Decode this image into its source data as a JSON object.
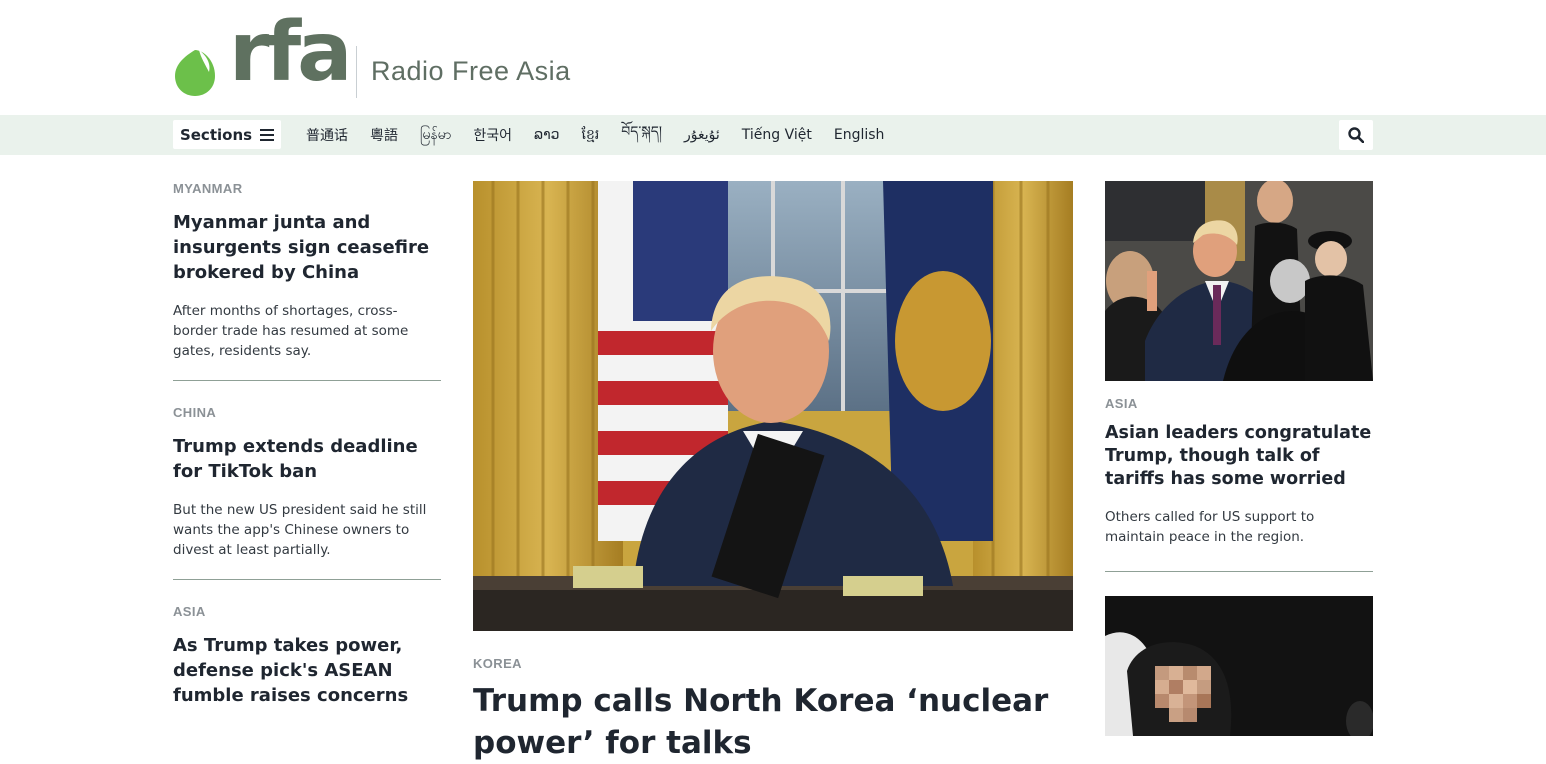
{
  "header": {
    "logo_text": "rfa",
    "tagline": "Radio Free Asia",
    "colors": {
      "brand_green": "#6cc04a",
      "logo_gray": "#5f7160",
      "nav_bg": "#eaf2ec"
    }
  },
  "nav": {
    "sections_label": "Sections",
    "sections_icon": "hamburger-icon",
    "languages": [
      "普通话",
      "粵語",
      "မြန်မာ",
      "한국어",
      "ລາວ",
      "ខ្មែរ",
      "བོད་སྐད།",
      "ئۇيغۇر",
      "Tiếng Việt",
      "English"
    ],
    "search_icon": "search-icon"
  },
  "left_stories": [
    {
      "kicker": "MYANMAR",
      "headline": "Myanmar junta and insurgents sign ceasefire brokered by China",
      "dek": "After months of shortages, cross-border trade has resumed at some gates, residents say."
    },
    {
      "kicker": "CHINA",
      "headline": "Trump extends deadline for TikTok ban",
      "dek": "But the new US president said he still wants the app's Chinese owners to divest at least partially."
    },
    {
      "kicker": "ASIA",
      "headline": "As Trump takes power, defense pick's ASEAN fumble raises concerns",
      "dek": ""
    }
  ],
  "main_story": {
    "kicker": "KOREA",
    "headline": "Trump calls North Korea ‘nuclear power’ for talks"
  },
  "right_stories": [
    {
      "kicker": "ASIA",
      "headline": "Asian leaders congratulate Trump, though talk of tariffs has some worried",
      "dek": "Others called for US support to maintain peace in the region."
    }
  ]
}
